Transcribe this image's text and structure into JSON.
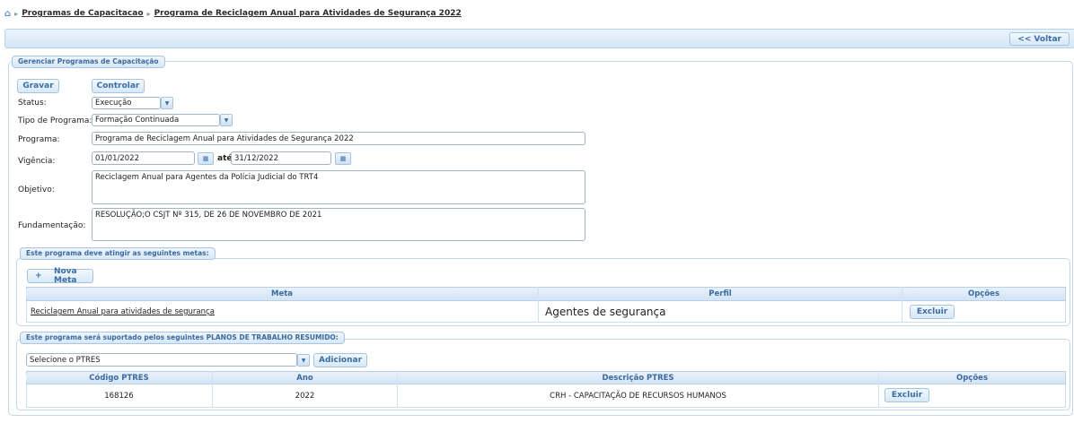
{
  "breadcrumb": {
    "item1": "Programas de Capacitacao",
    "item2": "Programa de Reciclagem Anual para Atividades de Segurança 2022"
  },
  "topbar": {
    "voltar": "<< Voltar"
  },
  "main": {
    "legend": "Gerenciar Programas de Capacitação",
    "buttons": {
      "gravar": "Gravar",
      "controlar": "Controlar"
    },
    "fields": {
      "status_label": "Status:",
      "status_value": "Execução",
      "tipo_label": "Tipo de Programa:",
      "tipo_value": "Formação Continuada",
      "programa_label": "Programa:",
      "programa_value": "Programa de Reciclagem Anual para Atividades de Segurança 2022",
      "vigencia_label": "Vigência:",
      "vigencia_inicio": "01/01/2022",
      "ate": "até",
      "vigencia_fim": "31/12/2022",
      "objetivo_label": "Objetivo:",
      "objetivo_value": "Reciclagem Anual para Agentes da Polícia Judicial do TRT4",
      "fundamentacao_label": "Fundamentação:",
      "fundamentacao_value": "RESOLUÇÃO;O CSJT Nº 315, DE 26 DE NOVEMBRO DE 2021"
    }
  },
  "metas": {
    "legend": "Este programa deve atingir as seguintes metas:",
    "nova_meta": "Nova Meta",
    "columns": {
      "meta": "Meta",
      "perfil": "Perfil",
      "opcoes": "Opções"
    },
    "rows": [
      {
        "meta": "Reciclagem Anual para atividades de segurança",
        "perfil": "Agentes de segurança",
        "acao": "Excluir"
      }
    ]
  },
  "ptres": {
    "legend": "Este programa será suportado pelos seguintes PLANOS DE TRABALHO RESUMIDO:",
    "select_placeholder": "Selecione o PTRES",
    "adicionar": "Adicionar",
    "columns": {
      "codigo": "Código PTRES",
      "ano": "Ano",
      "descricao": "Descrição PTRES",
      "opcoes": "Opções"
    },
    "rows": [
      {
        "codigo": "168126",
        "ano": "2022",
        "descricao": "CRH - CAPACITAÇÃO DE RECURSOS HUMANOS",
        "acao": "Excluir"
      }
    ]
  },
  "icons": {
    "home": "home-icon",
    "calendar": "calendar-icon",
    "dropdown": "dropdown-arrow-icon",
    "plus": "plus-icon"
  },
  "colors": {
    "accent": "#3b6aa0",
    "header_bg": "#d5e6f6",
    "border": "#a6c4e0"
  }
}
